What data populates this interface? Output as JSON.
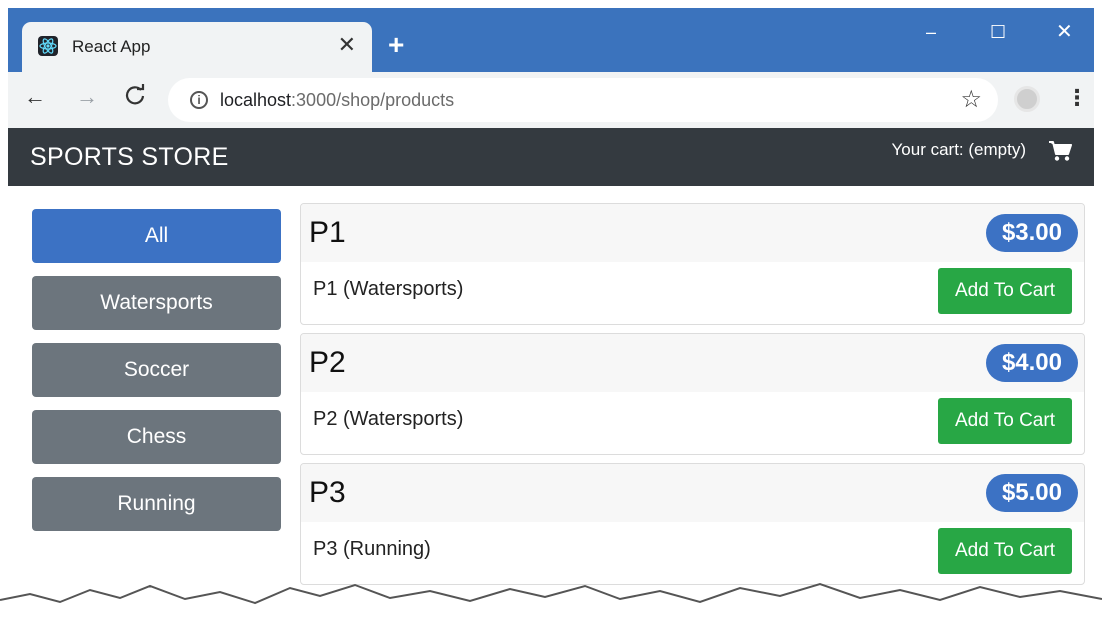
{
  "browser": {
    "tab_title": "React App",
    "tab_close_icon": "close-icon",
    "new_tab_label": "+",
    "window_controls": {
      "minimize": "–",
      "maximize": "☐",
      "close": "✕"
    },
    "url_host": "localhost",
    "url_path": ":3000/shop/products",
    "nav": {
      "back": "←",
      "forward": "→",
      "reload": "C"
    }
  },
  "header": {
    "brand": "SPORTS STORE",
    "cart_summary": "Your cart: (empty)",
    "cart_icon": "shopping-cart-icon"
  },
  "categories": [
    {
      "label": "All",
      "active": true
    },
    {
      "label": "Watersports",
      "active": false
    },
    {
      "label": "Soccer",
      "active": false
    },
    {
      "label": "Chess",
      "active": false
    },
    {
      "label": "Running",
      "active": false
    }
  ],
  "products": [
    {
      "name": "P1",
      "price": "$3.00",
      "description": "P1 (Watersports)",
      "button": "Add To Cart"
    },
    {
      "name": "P2",
      "price": "$4.00",
      "description": "P2 (Watersports)",
      "button": "Add To Cart"
    },
    {
      "name": "P3",
      "price": "$5.00",
      "description": "P3 (Running)",
      "button": "Add To Cart"
    }
  ],
  "colors": {
    "titlebar": "#3b73bd",
    "header": "#343a40",
    "primary": "#3c72c4",
    "secondary": "#6c757d",
    "success": "#28a745"
  }
}
